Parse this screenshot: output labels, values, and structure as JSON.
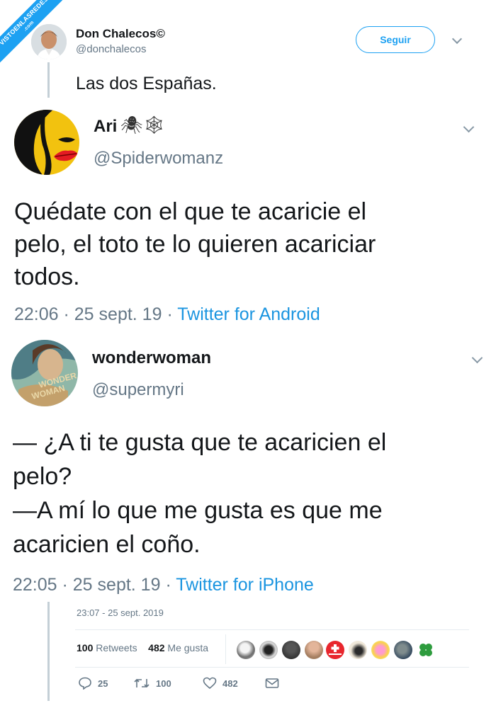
{
  "watermark": {
    "line1": "VISTOENLASREDES",
    "line2": ".com"
  },
  "main_tweet": {
    "author_name": "Don Chalecos©",
    "author_handle": "@donchalecos",
    "follow_label": "Seguir",
    "text": "Las dos Españas.",
    "timestamp": "23:07 - 25 sept. 2019",
    "retweets_count": "100",
    "retweets_label": "Retweets",
    "likes_count": "482",
    "likes_label": "Me gusta",
    "actions": {
      "replies": "25",
      "retweets": "100",
      "likes": "482"
    }
  },
  "quoted_1": {
    "author_name": "Ari",
    "author_emoji": "🕷🕸",
    "author_handle": "@Spiderwomanz",
    "text_lines": [
      "Quédate con el que te acaricie el",
      "pelo, el toto te lo quieren acariciar",
      "todos."
    ],
    "time": "22:06",
    "date": "25 sept. 19",
    "source": "Twitter for Android"
  },
  "quoted_2": {
    "author_name": "wonderwoman",
    "author_handle": "@supermyri",
    "text_lines": [
      "— ¿A ti te gusta que te acaricien el",
      "pelo?",
      "—A mí lo que me gusta es que me",
      "acaricien el coño."
    ],
    "time": "22:05",
    "date": "25 sept. 19",
    "source": "Twitter for iPhone"
  },
  "colors": {
    "accent": "#1da1f2",
    "muted": "#657786",
    "link": "#1b95e0"
  }
}
